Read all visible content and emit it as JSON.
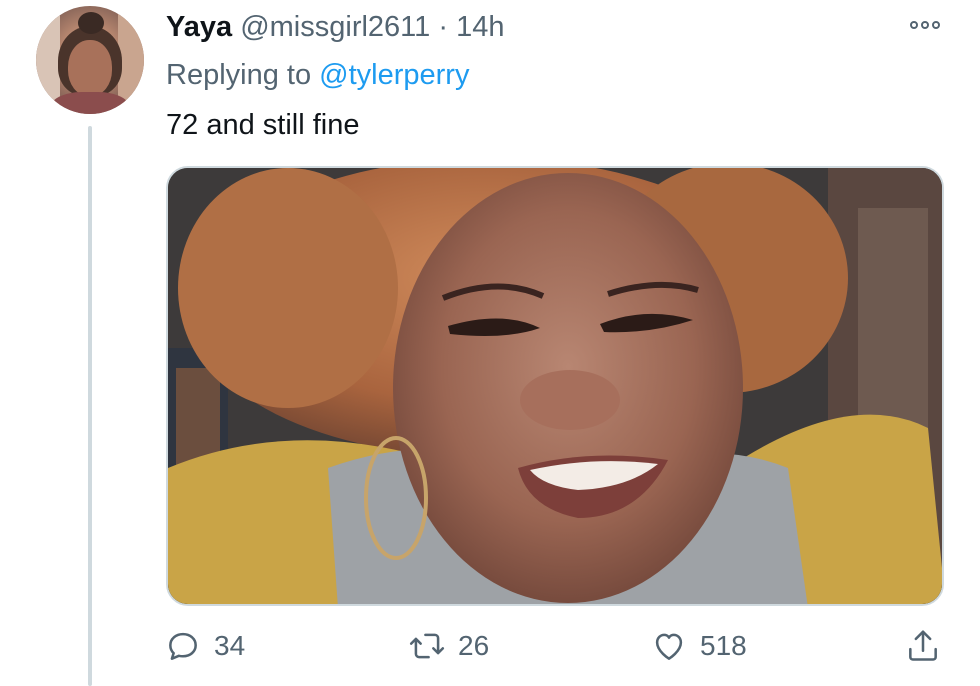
{
  "tweet": {
    "author_name": "Yaya",
    "handle": "@missgirl2611",
    "separator": "·",
    "time": "14h",
    "replying_prefix": "Replying to",
    "replying_to": "@tylerperry",
    "text": "72 and still fine"
  },
  "actions": {
    "reply_count": "34",
    "retweet_count": "26",
    "like_count": "518"
  },
  "colors": {
    "accent": "#1d9bf0",
    "muted": "#536471",
    "thread_line": "#cfd9de"
  },
  "icons": [
    "more-icon",
    "reply-icon",
    "retweet-icon",
    "like-icon",
    "share-icon"
  ]
}
